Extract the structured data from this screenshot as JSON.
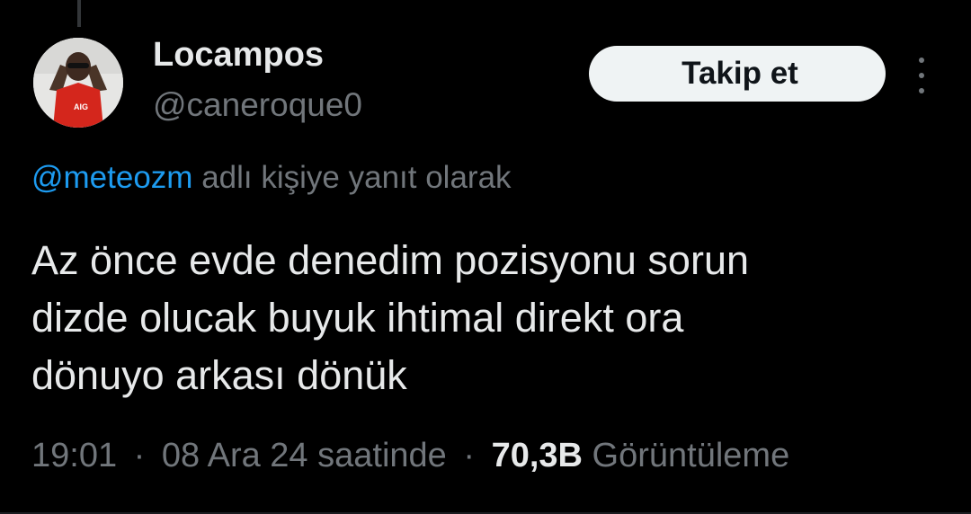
{
  "author": {
    "display_name": "Locampos",
    "handle": "@caneroque0",
    "avatar_label": "AIG"
  },
  "follow_button": {
    "label": "Takip et"
  },
  "reply_context": {
    "mention": "@meteozm",
    "suffix": "adlı kişiye yanıt olarak"
  },
  "tweet": {
    "lines": [
      "Az önce evde denedim pozisyonu sorun",
      "dizde olucak buyuk ihtimal direkt ora",
      "dönuyo arkası dönük"
    ]
  },
  "meta": {
    "time": "19:01",
    "date": "08 Ara 24 saatinde",
    "separator": "·",
    "views_count": "70,3B",
    "views_label": "Görüntüleme"
  },
  "colors": {
    "background": "#000000",
    "text_primary": "#e7e9ea",
    "text_secondary": "#71767b",
    "accent": "#1d9bf0",
    "button_bg": "#eff3f4"
  },
  "icons": {
    "more": "more-vertical-icon"
  }
}
